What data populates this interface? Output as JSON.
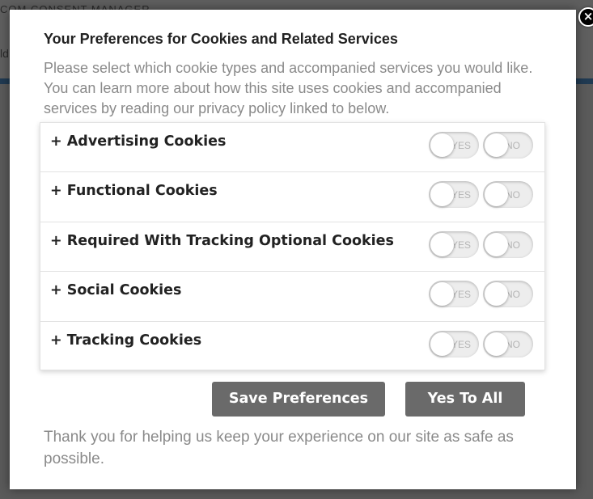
{
  "background": {
    "title": "COM CONSENT MANAGER",
    "sub": "ld"
  },
  "modal": {
    "close_label": "×",
    "title": "Your Preferences for Cookies and Related Services",
    "intro": "Please select which cookie types and accompanied services you would like. You can learn more about how this site uses cookies and accompanied services by reading our privacy policy linked to below.",
    "categories": [
      {
        "label": "+ Advertising Cookies",
        "yes_label": "YES",
        "no_label": "NO"
      },
      {
        "label": "+ Functional Cookies",
        "yes_label": "YES",
        "no_label": "NO"
      },
      {
        "label": "+ Required With Tracking Optional Cookies",
        "yes_label": "YES",
        "no_label": "NO"
      },
      {
        "label": "+ Social Cookies",
        "yes_label": "YES",
        "no_label": "NO"
      },
      {
        "label": "+ Tracking Cookies",
        "yes_label": "YES",
        "no_label": "NO"
      }
    ],
    "save_button": "Save Preferences",
    "yes_all_button": "Yes To All",
    "footer": "Thank you for helping us keep your experience on our site as safe as possible."
  },
  "colors": {
    "overlay": "#5a5a5a",
    "button": "#6a6a6a",
    "muted_text": "#8a8a8a",
    "accent_rule": "#203a52"
  }
}
